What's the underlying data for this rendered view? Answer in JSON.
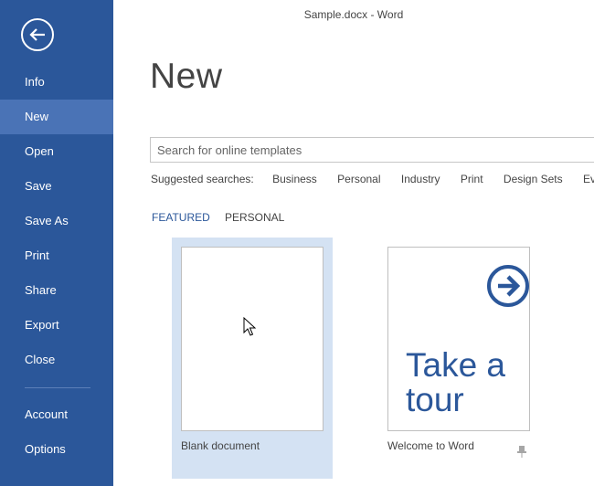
{
  "window": {
    "title": "Sample.docx - Word"
  },
  "nav": {
    "back_label": "Back",
    "items": [
      {
        "label": "Info"
      },
      {
        "label": "New"
      },
      {
        "label": "Open"
      },
      {
        "label": "Save"
      },
      {
        "label": "Save As"
      },
      {
        "label": "Print"
      },
      {
        "label": "Share"
      },
      {
        "label": "Export"
      },
      {
        "label": "Close"
      },
      {
        "label": "Account"
      },
      {
        "label": "Options"
      }
    ],
    "active": "New"
  },
  "main": {
    "heading": "New",
    "search": {
      "placeholder": "Search for online templates",
      "value": ""
    },
    "suggested": {
      "label": "Suggested searches:",
      "links": [
        "Business",
        "Personal",
        "Industry",
        "Print",
        "Design Sets",
        "Event"
      ]
    },
    "tabs": [
      {
        "label": "FEATURED",
        "active": true
      },
      {
        "label": "PERSONAL",
        "active": false
      }
    ],
    "templates": [
      {
        "label": "Blank document",
        "selected": true
      },
      {
        "label": "Welcome to Word",
        "thumb_text_line1": "Take a",
        "thumb_text_line2": "tour",
        "pinned": true
      }
    ]
  },
  "colors": {
    "accent": "#2b579a",
    "nav_active": "#4a73b6",
    "selection": "#d4e2f3"
  },
  "icons": {
    "back": "arrow-left-circle-icon",
    "tour": "arrow-right-circle-icon",
    "pin": "pin-icon",
    "cursor": "mouse-pointer-icon"
  }
}
